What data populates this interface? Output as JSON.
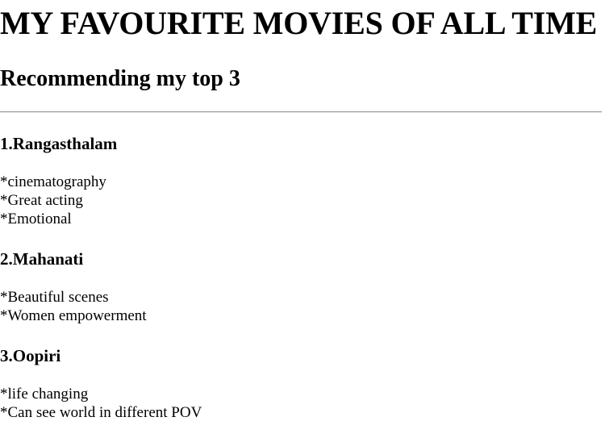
{
  "page": {
    "title": "MY FAVOURITE MOVIES OF ALL TIME",
    "subtitle": "Recommending my top 3"
  },
  "movies": [
    {
      "title": "1.Rangasthalam",
      "reasons": [
        "*cinematography",
        "*Great acting",
        "*Emotional"
      ]
    },
    {
      "title": "2.Mahanati",
      "reasons": [
        "*Beautiful scenes",
        "*Women empowerment"
      ]
    },
    {
      "title": "3.Oopiri",
      "reasons": [
        "*life changing",
        "*Can see world in different POV"
      ]
    }
  ],
  "colors": {
    "text": "#000000",
    "background": "#ffffff",
    "divider": "#9a9a9a"
  }
}
